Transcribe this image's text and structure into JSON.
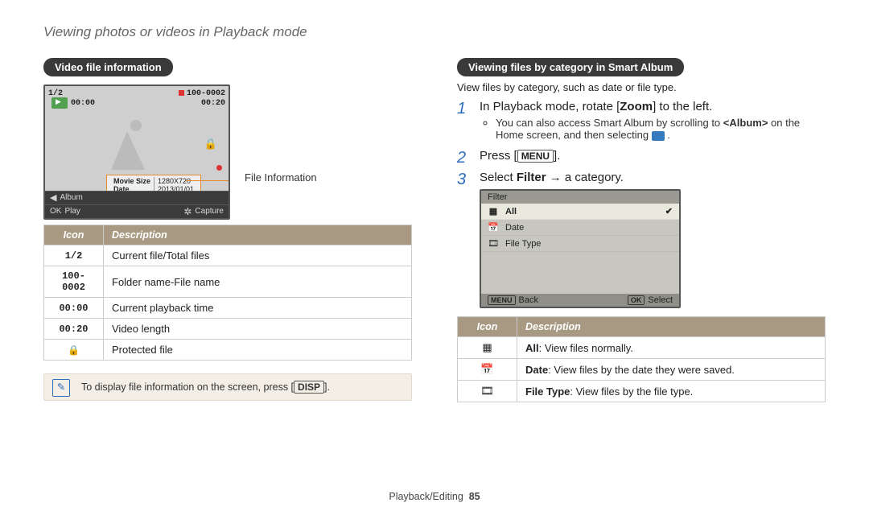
{
  "page_title": "Viewing photos or videos in Playback mode",
  "left": {
    "heading": "Video file information",
    "cam": {
      "counter": "1/2",
      "file": "100-0002",
      "time1": "00:00",
      "time2": "00:20",
      "movie_size_label": "Movie Size",
      "movie_size_value": "1280X720",
      "date_label": "Date",
      "date_value": "2013/01/01",
      "album": "Album",
      "play_lbl": "Play",
      "capture_lbl": "Capture",
      "ok": "OK"
    },
    "fi_label": "File Information",
    "table": {
      "h_icon": "Icon",
      "h_desc": "Description",
      "rows": [
        {
          "icon": "1/2",
          "desc": "Current file/Total files"
        },
        {
          "icon": "100-0002",
          "desc": "Folder name-File name"
        },
        {
          "icon": "00:00",
          "desc": "Current playback time"
        },
        {
          "icon": "00:20",
          "desc": "Video length"
        },
        {
          "icon": "🔒",
          "desc": "Protected file"
        }
      ]
    },
    "note_pre": "To display file information on the screen, press [",
    "note_key": "DISP",
    "note_post": "]."
  },
  "right": {
    "heading": "Viewing files by category in Smart Album",
    "intro": "View files by category, such as date or file type.",
    "step1_a": "In Playback mode, rotate [",
    "step1_b": "Zoom",
    "step1_c": "] to the left.",
    "step1_sub_a": "You can also access Smart Album by scrolling to ",
    "step1_sub_b": "<Album>",
    "step1_sub_c": " on the Home screen, and then selecting ",
    "step2_a": "Press [",
    "step2_key": "MENU",
    "step2_b": "].",
    "step3_a": "Select ",
    "step3_b": "Filter",
    "step3_c": " → a category.",
    "cam2": {
      "title": "Filter",
      "items": [
        {
          "icon": "▦",
          "label": "All",
          "sel": true
        },
        {
          "icon": "📅",
          "label": "Date",
          "sel": false
        },
        {
          "icon": "🎞",
          "label": "File Type",
          "sel": false
        }
      ],
      "back_key": "MENU",
      "back_lbl": "Back",
      "sel_key": "OK",
      "sel_lbl": "Select"
    },
    "table": {
      "h_icon": "Icon",
      "h_desc": "Description",
      "rows": [
        {
          "icon": "▦",
          "b": "All",
          "rest": ": View files normally."
        },
        {
          "icon": "📅",
          "b": "Date",
          "rest": ": View files by the date they were saved."
        },
        {
          "icon": "🎞",
          "b": "File Type",
          "rest": ": View files by the file type."
        }
      ]
    }
  },
  "footer_section": "Playback/Editing",
  "footer_page": "85"
}
